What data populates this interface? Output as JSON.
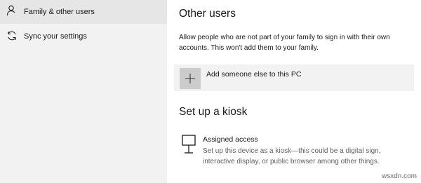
{
  "sidebar": {
    "items": [
      {
        "label": "Family & other users",
        "icon": "person-icon",
        "active": true
      },
      {
        "label": "Sync your settings",
        "icon": "sync-icon",
        "active": false
      }
    ]
  },
  "other_users": {
    "title": "Other users",
    "description": "Allow people who are not part of your family to sign in with their own accounts. This won't add them to your family.",
    "add_label": "Add someone else to this PC",
    "add_icon": "plus-icon"
  },
  "kiosk": {
    "title": "Set up a kiosk",
    "item_title": "Assigned access",
    "item_description": "Set up this device as a kiosk—this could be a digital sign, interactive display, or public browser among other things.",
    "item_icon": "kiosk-icon"
  },
  "watermark": "wsxdn.com",
  "colors": {
    "sidebar_bg": "#f2f2f2",
    "active_item_bg": "#e6e6e6",
    "add_row_bg": "#f2f2f2",
    "add_tile_bg": "#cccccc",
    "secondary_text": "#5f5f5f"
  }
}
